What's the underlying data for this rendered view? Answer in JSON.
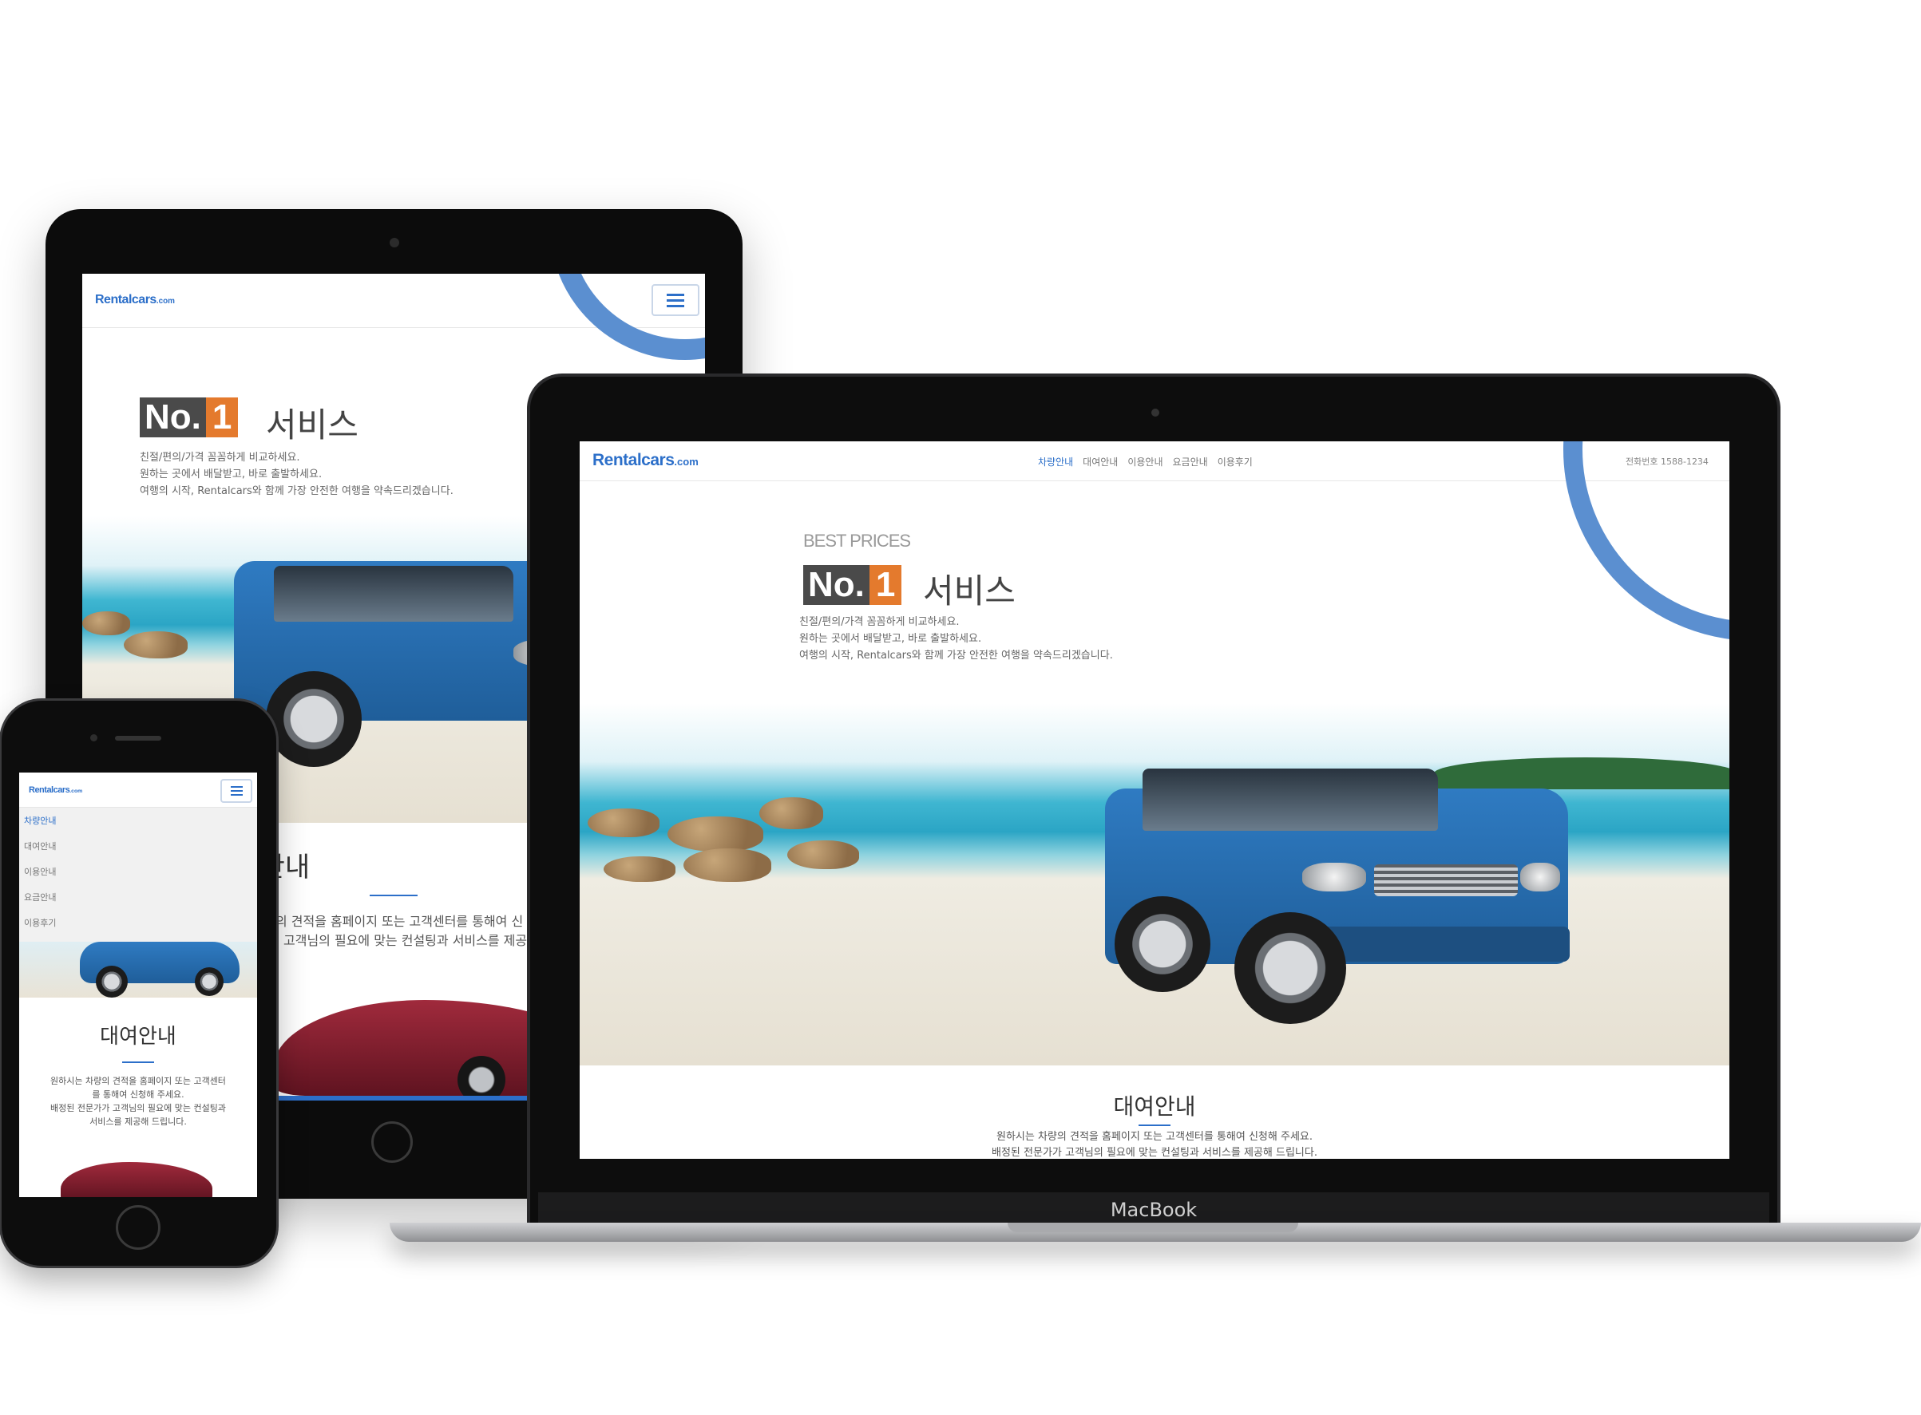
{
  "site": {
    "logo_main": "Rentalcars",
    "logo_suffix": ".com",
    "nav": [
      "차량안내",
      "대여안내",
      "이용안내",
      "요금안내",
      "이용후기"
    ],
    "phone": "전화번호 1588-1234"
  },
  "hero": {
    "best_prices": "BEST PRICES",
    "badge_no": "No.",
    "badge_one": "1",
    "service": "서비스",
    "lines": [
      "친절/편의/가격 꼼꼼하게 비교하세요.",
      "원하는 곳에서 배달받고, 바로 출발하세요.",
      "여행의 시작, Rentalcars와 함께  가장 안전한 여행을 약속드리겠습니다."
    ]
  },
  "rental": {
    "title": "대여안내",
    "desktop_lines": [
      "원하시는 차량의 견적을 홈페이지 또는 고객센터를 통해여 신청해 주세요.",
      "배정된 전문가가 고객님의 필요에 맞는 컨설팅과 서비스를 제공해 드립니다."
    ],
    "tablet_lines": [
      "의 견적을 홈페이지 또는 고객센터를 통해여 신",
      "고객님의 필요에 맞는 컨설팅과 서비스를 제공"
    ],
    "mobile_lines": [
      "원하시는 차량의 견적을 홈페이지 또는 고객센터",
      "를 통해여 신청해 주세요.",
      "배정된 전문가가 고객님의 필요에 맞는 컨설팅과",
      "서비스를 제공해 드립니다."
    ]
  },
  "device": {
    "laptop_brand": "MacBook"
  },
  "colors": {
    "accent": "#2c6fc9",
    "badge_dark": "#4a4a4a",
    "badge_orange": "#e47a2d",
    "arc": "#5b8fd0"
  },
  "icons": {
    "menu": "hamburger-icon"
  }
}
